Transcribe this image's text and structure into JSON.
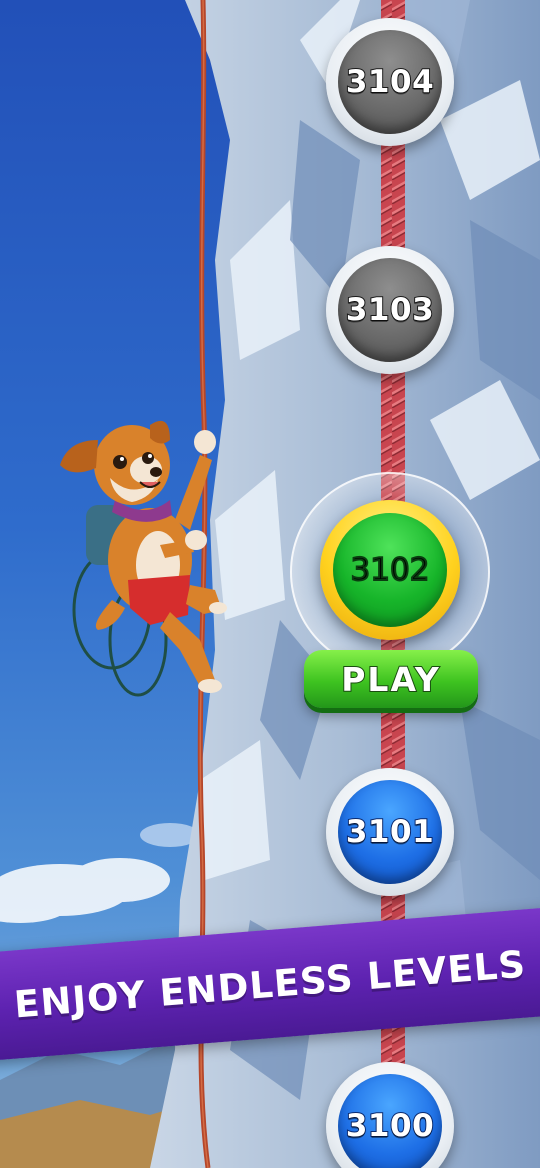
{
  "levels": [
    {
      "number": "3104",
      "state": "locked"
    },
    {
      "number": "3103",
      "state": "locked"
    },
    {
      "number": "3102",
      "state": "current"
    },
    {
      "number": "3101",
      "state": "completed"
    },
    {
      "number": "3100",
      "state": "completed"
    }
  ],
  "play_button": {
    "label": "PLAY"
  },
  "promo_banner": {
    "text": "ENJOY ENDLESS LEVELS"
  },
  "character": {
    "name": "climbing-dog"
  },
  "colors": {
    "sky": "#2f67c9",
    "locked_level": "#6a6a6a",
    "completed_level": "#1e6fe6",
    "current_level": "#17b52a",
    "current_ring": "#ffd21f",
    "play_button": "#3ec320",
    "banner": "#5d22b0",
    "rope_center": "#c8454f",
    "rope_side": "#b5462a"
  }
}
